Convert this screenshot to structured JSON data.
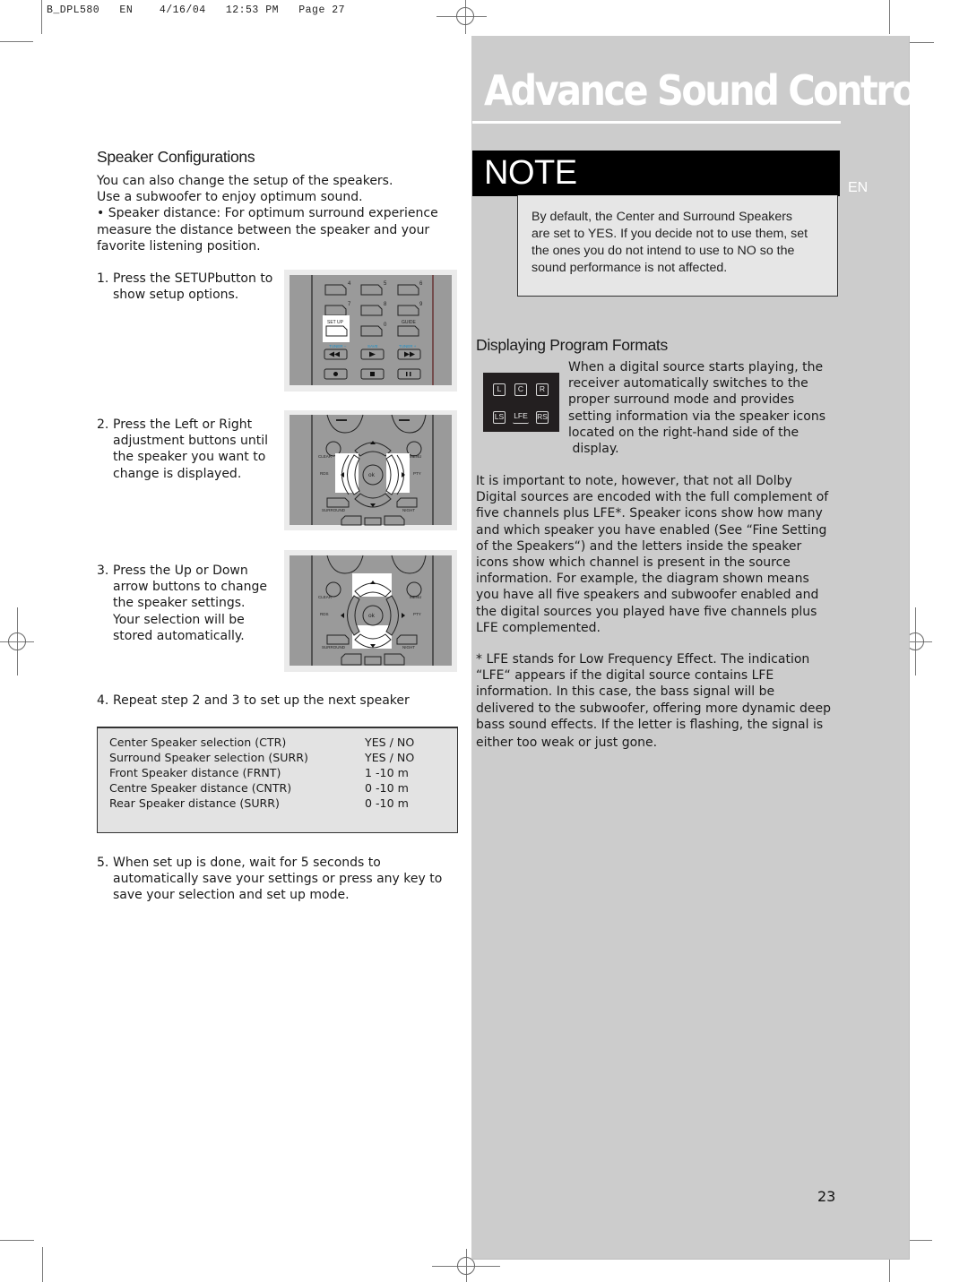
{
  "print_slug": "B_DPL580   EN    4/16/04   12:53 PM   Page 27",
  "page_title": "Advance Sound Control",
  "language_tab": "EN",
  "page_number": "23",
  "left": {
    "section_title": "Speaker Configurations",
    "intro": [
      "You can also change the setup of the speakers.",
      "Use a subwoofer to enjoy optimum sound.",
      "• Speaker distance:  For optimum surround experience",
      "measure the distance between the speaker and your",
      "favorite listening position."
    ],
    "steps": [
      {
        "num": "1.",
        "lines": [
          "Press the SETUPbutton to",
          "show setup options."
        ]
      },
      {
        "num": "2.",
        "lines": [
          "Press the Left or Right",
          "adjustment buttons until",
          "the speaker you want to",
          "change is displayed."
        ]
      },
      {
        "num": "3.",
        "lines": [
          "Press the Up or Down",
          "arrow buttons to change",
          "the speaker settings.",
          "Your selection will be",
          "stored automatically."
        ]
      },
      {
        "num": "4.",
        "lines": [
          "Repeat step 2 and 3 to set up the next speaker"
        ]
      },
      {
        "num": "5.",
        "lines": [
          "When set up is done, wait for 5 seconds to",
          "automatically save your settings or press any key to",
          "save your selection and set up mode."
        ]
      }
    ],
    "settings_table": [
      {
        "label": "Center Speaker selection  (CTR)",
        "value": "YES / NO"
      },
      {
        "label": "Surround Speaker selection (SURR)",
        "value": "YES / NO"
      },
      {
        "label": "Front Speaker distance (FRNT)",
        "value": "1 -10 m"
      },
      {
        "label": "Centre Speaker distance (CNTR)",
        "value": "0 -10 m"
      },
      {
        "label": "Rear Speaker distance (SURR)",
        "value": "0 -10 m"
      }
    ],
    "remote_1": {
      "keys": [
        "4",
        "5",
        "6",
        "7",
        "8",
        "9",
        "SET UP",
        "0",
        "GUIDE"
      ],
      "transport_labels": [
        "TUNER −",
        "SAVE",
        "TUNER +"
      ],
      "highlight": "SET UP"
    },
    "remote_2": {
      "labels": [
        "CLEAR",
        "MENU",
        "RDS",
        "PTY",
        "ok",
        "SURROUND",
        "NIGHT"
      ],
      "highlight": "left-right"
    },
    "remote_3": {
      "labels": [
        "CLEAR",
        "MENU",
        "RDS",
        "PTY",
        "ok",
        "SURROUND",
        "NIGHT"
      ],
      "highlight": "up-down"
    }
  },
  "right": {
    "note_label": "NOTE",
    "note_text": [
      "By default, the Center and Surround Speakers",
      "are set to YES. If you decide not to use them, set",
      "the ones you do not intend to use to NO so the",
      "sound performance is not affected."
    ],
    "section_title": "Displaying Program Formats",
    "speaker_icons": [
      "L",
      "C",
      "R",
      "LS",
      "LFE",
      "RS"
    ],
    "para1": [
      "When a digital source starts playing, the",
      "receiver automatically switches to the",
      "proper surround mode and provides",
      "setting information via the speaker icons",
      "located on the right-hand side of the",
      " display."
    ],
    "para2": [
      "It is important to note, however, that not all Dolby",
      "Digital sources are encoded with the full complement of",
      "five channels plus LFE*. Speaker icons show how many",
      "and which speaker you have enabled (See “Fine Setting",
      "of the Speakers“) and the letters inside the speaker",
      "icons show which channel is present in the source",
      "information. For example, the diagram shown means",
      "you have all five speakers and subwoofer enabled and",
      "the digital sources you played have five channels plus",
      "LFE complemented."
    ],
    "para3": [
      "* LFE stands for Low Frequency Effect. The indication",
      "“LFE“ appears if the digital source contains LFE",
      "information. In this case, the bass signal will be",
      "delivered to the subwoofer, offering more dynamic deep",
      "bass sound effects. If the letter is flashing, the signal is",
      "either too weak or just gone."
    ]
  }
}
